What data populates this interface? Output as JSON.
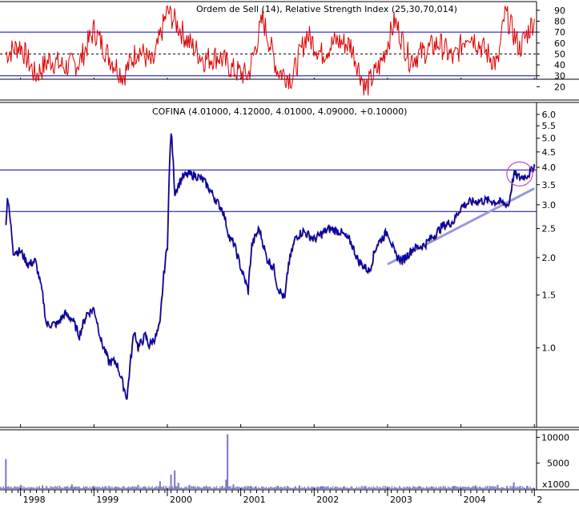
{
  "chart_data": [
    {
      "type": "line",
      "panel": "indicator",
      "title": "Ordem de Sell (14), Relative Strength Index (25,30,70,014)",
      "color": "#dd0000",
      "ylim": [
        10,
        95
      ],
      "yticks": [
        20,
        30,
        40,
        50,
        60,
        70,
        80,
        90
      ],
      "reference_lines": [
        {
          "value": 70,
          "style": "solid",
          "color": "#0000cc"
        },
        {
          "value": 50,
          "style": "dashed",
          "color": "#000000"
        },
        {
          "value": 30,
          "style": "solid",
          "color": "#0000cc"
        }
      ],
      "series": [
        {
          "x": [
            1997.8,
            1998.0,
            1998.2,
            1998.4,
            1998.6,
            1998.8,
            1999.0,
            1999.2,
            1999.4,
            1999.6,
            1999.8,
            2000.0,
            2000.1,
            2000.3,
            2000.5,
            2000.7,
            2000.9,
            2001.1,
            2001.3,
            2001.5,
            2001.7,
            2001.9,
            2002.1,
            2002.3,
            2002.5,
            2002.7,
            2002.9,
            2003.1,
            2003.3,
            2003.5,
            2003.7,
            2003.9,
            2004.1,
            2004.3,
            2004.5,
            2004.6,
            2004.8,
            2005.0
          ],
          "y": [
            50,
            58,
            30,
            45,
            38,
            42,
            72,
            48,
            30,
            55,
            40,
            90,
            80,
            60,
            45,
            48,
            35,
            30,
            82,
            35,
            28,
            68,
            50,
            62,
            58,
            18,
            40,
            80,
            45,
            52,
            60,
            45,
            70,
            55,
            40,
            88,
            55,
            82
          ]
        }
      ]
    },
    {
      "type": "line",
      "panel": "price",
      "title": "COFINA (4.01000, 4.12000, 4.01000, 4.09000, +0.10000)",
      "scale": "log",
      "ylim": [
        0.55,
        6.5
      ],
      "yticks": [
        1.0,
        1.5,
        2.0,
        2.5,
        3.0,
        3.5,
        4.0,
        4.5,
        5.0,
        5.5,
        6.0
      ],
      "xticks": [
        "1998",
        "1999",
        "2000",
        "2001",
        "2002",
        "2003",
        "2004",
        "2"
      ],
      "grid": false,
      "horizontal_lines": [
        3.92,
        2.85
      ],
      "trendline": {
        "from": [
          2003.0,
          1.9
        ],
        "to": [
          2005.0,
          3.4
        ]
      },
      "highlight_circle": {
        "x": 2004.8,
        "y": 3.8
      },
      "series": [
        {
          "x": [
            1997.8,
            1997.82,
            1997.9,
            1998.0,
            1998.1,
            1998.2,
            1998.3,
            1998.35,
            1998.5,
            1998.6,
            1998.7,
            1998.8,
            1998.9,
            1999.0,
            1999.1,
            1999.2,
            1999.3,
            1999.4,
            1999.45,
            1999.55,
            1999.6,
            1999.7,
            1999.75,
            1999.85,
            1999.9,
            1999.95,
            2000.0,
            2000.05,
            2000.1,
            2000.2,
            2000.3,
            2000.4,
            2000.5,
            2000.6,
            2000.7,
            2000.75,
            2000.85,
            2000.9,
            2001.0,
            2001.1,
            2001.15,
            2001.25,
            2001.35,
            2001.45,
            2001.5,
            2001.6,
            2001.65,
            2001.75,
            2001.85,
            2002.0,
            2002.2,
            2002.35,
            2002.5,
            2002.6,
            2002.75,
            2002.85,
            2003.0,
            2003.1,
            2003.2,
            2003.35,
            2003.5,
            2003.65,
            2003.75,
            2003.9,
            2004.0,
            2004.1,
            2004.25,
            2004.4,
            2004.55,
            2004.65,
            2004.72,
            2004.8,
            2004.88,
            2004.95,
            2005.0
          ],
          "y": [
            2.55,
            3.2,
            2.1,
            2.1,
            1.9,
            1.95,
            1.5,
            1.2,
            1.2,
            1.3,
            1.25,
            1.1,
            1.3,
            1.35,
            1.05,
            0.9,
            0.9,
            0.75,
            0.68,
            1.15,
            1.0,
            1.1,
            1.02,
            1.1,
            1.2,
            1.75,
            2.2,
            5.3,
            3.3,
            3.7,
            3.8,
            3.75,
            3.6,
            3.3,
            3.0,
            2.9,
            2.3,
            2.25,
            1.85,
            1.55,
            2.2,
            2.5,
            2.0,
            1.85,
            1.6,
            1.45,
            1.9,
            2.35,
            2.45,
            2.3,
            2.5,
            2.45,
            2.25,
            1.95,
            1.8,
            2.2,
            2.45,
            2.05,
            1.95,
            2.15,
            2.2,
            2.4,
            2.55,
            2.65,
            2.95,
            3.05,
            3.1,
            3.1,
            3.05,
            3.0,
            3.8,
            3.7,
            3.75,
            3.85,
            4.1
          ]
        }
      ]
    },
    {
      "type": "bar",
      "panel": "volume",
      "ylabel": "x1000",
      "ylim": [
        0,
        11000
      ],
      "yticks": [
        5000,
        10000
      ],
      "color": "#7777cc",
      "series": [
        {
          "x": [
            1997.8,
            1998.0,
            1998.3,
            1998.7,
            1999.0,
            1999.3,
            1999.6,
            1999.9,
            2000.05,
            2000.1,
            2000.15,
            2000.3,
            2000.5,
            2000.75,
            2000.8,
            2000.82,
            2000.9,
            2001.2,
            2001.5,
            2001.8,
            2002.1,
            2002.4,
            2002.7,
            2003.0,
            2003.3,
            2003.6,
            2003.9,
            2004.2,
            2004.5,
            2004.72,
            2004.9
          ],
          "values": [
            5800,
            800,
            700,
            900,
            600,
            500,
            800,
            1500,
            2800,
            3600,
            1200,
            800,
            500,
            600,
            1800,
            10600,
            900,
            500,
            600,
            700,
            500,
            400,
            600,
            500,
            400,
            500,
            600,
            700,
            800,
            1300,
            600
          ]
        }
      ]
    }
  ]
}
